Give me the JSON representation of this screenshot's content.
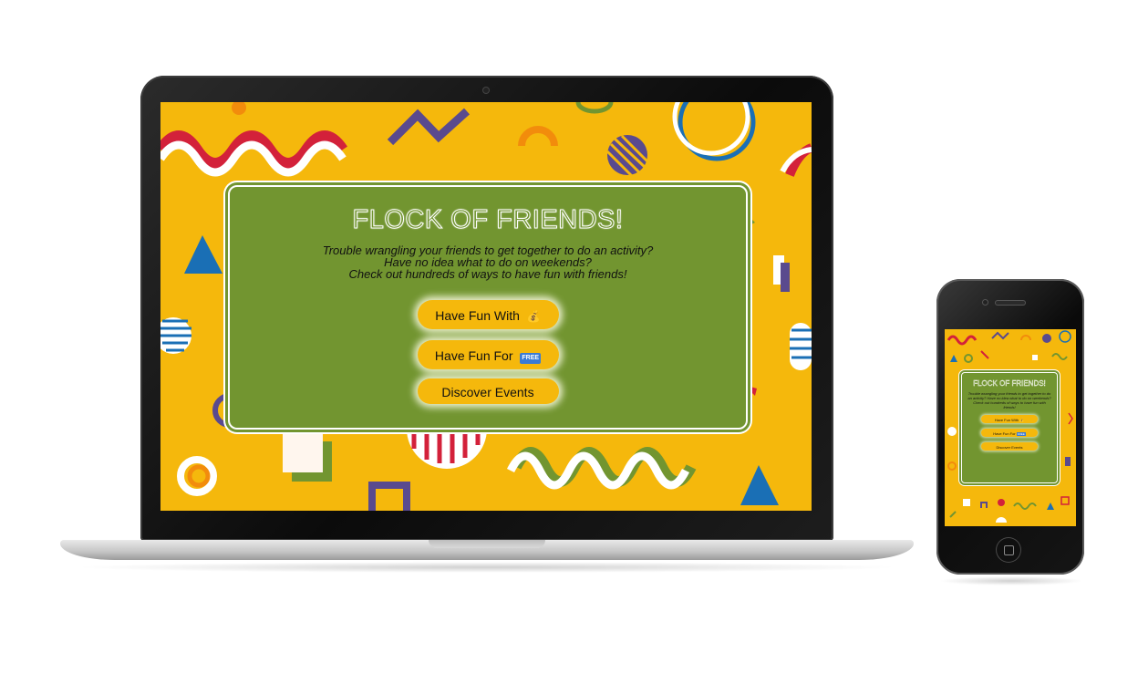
{
  "site": {
    "title": "FLOCK OF FRIENDS!",
    "intro_lines": [
      "Trouble wrangling your friends to get together to do an activity?",
      "Have no idea what to do on weekends?",
      "Check out hundreds of ways to have fun with friends!"
    ],
    "buttons": {
      "fun_with": "Have Fun With",
      "fun_with_icon": "💰",
      "fun_for": "Have Fun For",
      "fun_for_badge": "FREE",
      "events": "Discover Events"
    }
  },
  "colors": {
    "background": "#f5b80c",
    "card": "#729530",
    "accent_red": "#d3213a",
    "accent_purple": "#5a4a8e",
    "accent_blue": "#1a6fb5",
    "accent_orange": "#f28c0c"
  }
}
